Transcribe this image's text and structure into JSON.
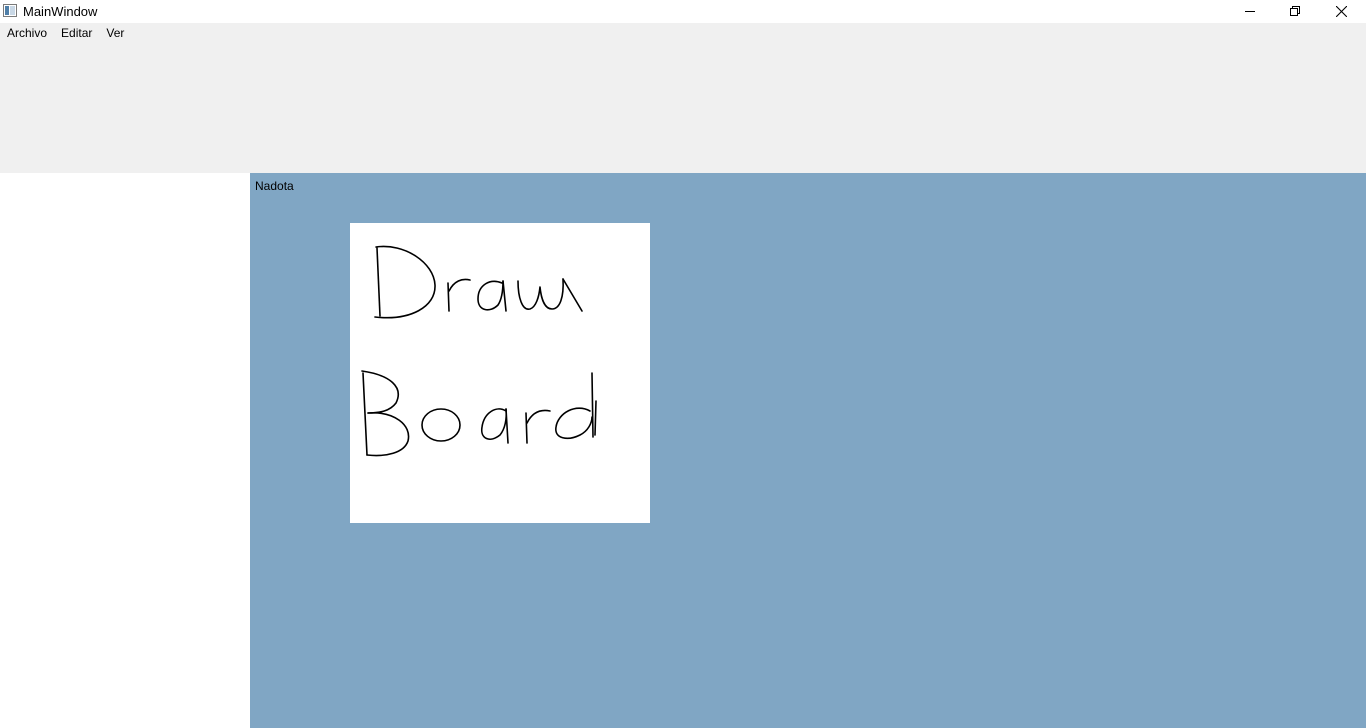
{
  "window": {
    "title": "MainWindow",
    "controls": {
      "minimize_icon": "minimize-icon",
      "maximize_icon": "restore-icon",
      "close_icon": "close-icon"
    }
  },
  "menubar": {
    "items": [
      {
        "label": "Archivo"
      },
      {
        "label": "Editar"
      },
      {
        "label": "Ver"
      }
    ]
  },
  "workspace": {
    "background_color": "#80a6c4",
    "note": {
      "label": "Nadota",
      "drawing_text": "Draw Board"
    }
  }
}
